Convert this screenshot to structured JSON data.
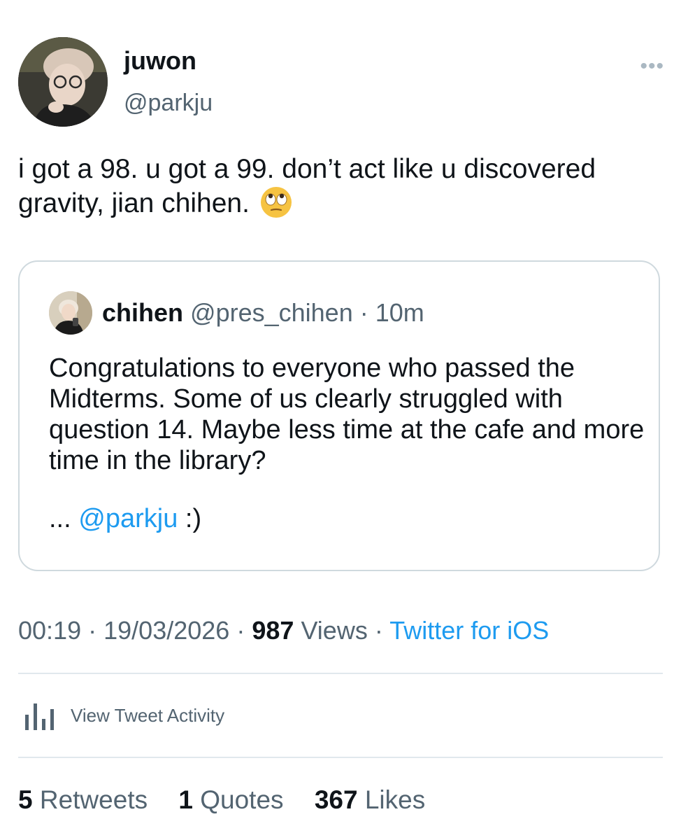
{
  "tweet": {
    "author": {
      "name": "juwon",
      "handle": "@parkju",
      "avatar_icon": "profile-photo"
    },
    "more_icon": "more-horizontal-icon",
    "text": "i got a 98. u got a 99. don’t act like u discovered gravity, jian chihen.",
    "emoji": "face-with-rolling-eyes"
  },
  "quoted_tweet": {
    "author": {
      "name": "chihen",
      "handle": "@pres_chihen",
      "separator": "·",
      "time": "10m"
    },
    "text": "Congratulations to everyone who passed the Midterms. Some of us clearly struggled with question 14. Maybe less time at the cafe and more time in the library?",
    "tail_prefix": "...",
    "mention": "@parkju",
    "tail_suffix": ":)"
  },
  "meta": {
    "time": "00:19",
    "date": "19/03/2026",
    "views_count": "987",
    "views_label": "Views",
    "separator": "·",
    "source": "Twitter for iOS"
  },
  "activity": {
    "label": "View Tweet Activity",
    "icon": "bar-chart-icon"
  },
  "stats": [
    {
      "count": "5",
      "label": "Retweets"
    },
    {
      "count": "1",
      "label": "Quotes"
    },
    {
      "count": "367",
      "label": "Likes"
    }
  ],
  "colors": {
    "accent": "#1d9bf0",
    "secondary_text": "#536471",
    "border": "#cfd9de"
  }
}
